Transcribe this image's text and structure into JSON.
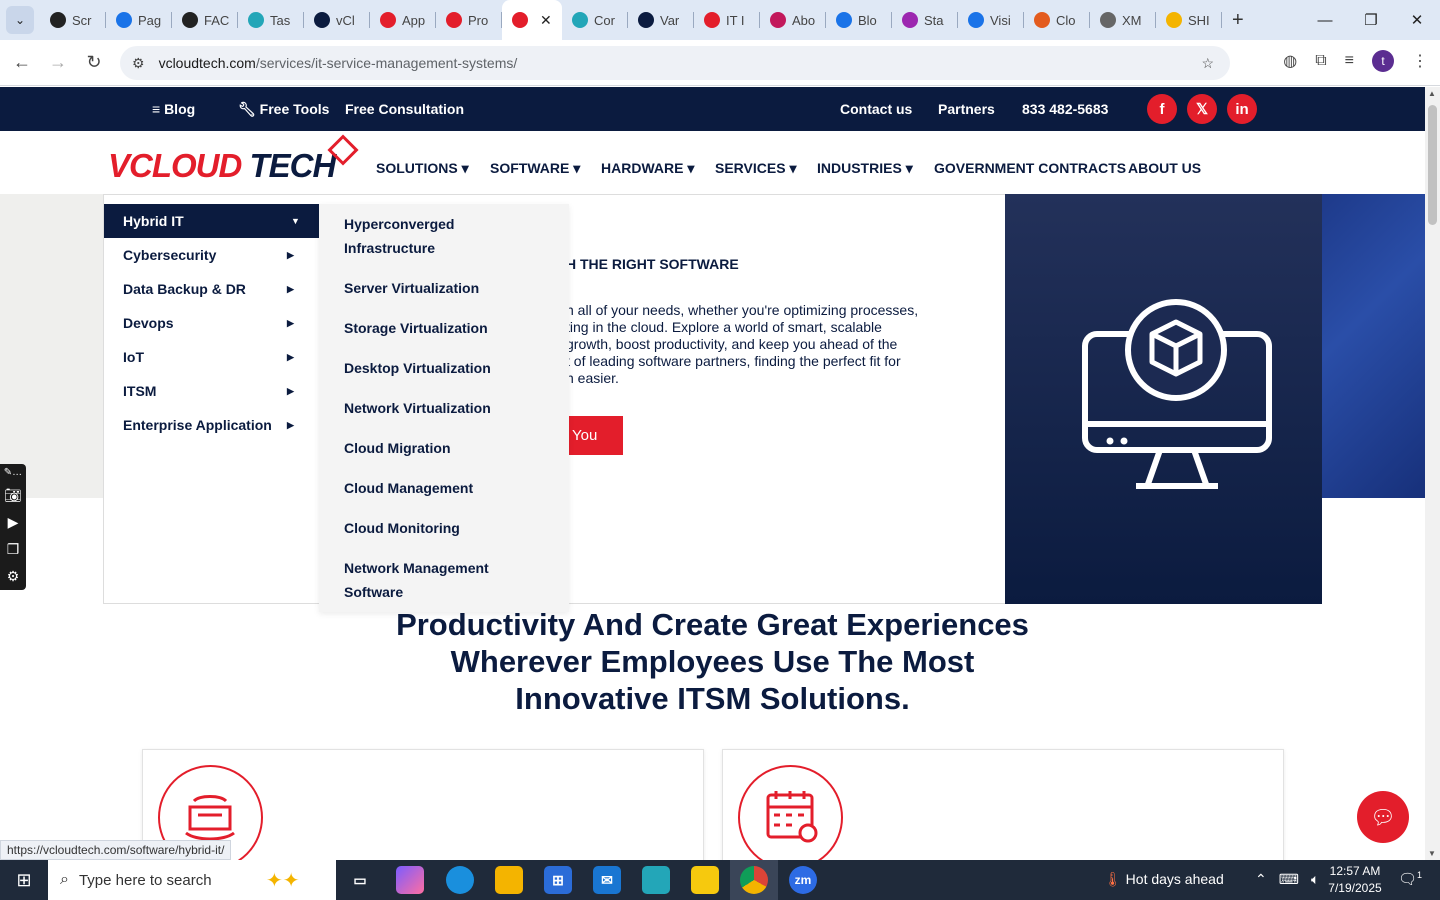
{
  "browser": {
    "tabs": [
      {
        "label": "Scr",
        "color": "#222222"
      },
      {
        "label": "Pag",
        "color": "#1a73e8"
      },
      {
        "label": "FAC",
        "color": "#222222"
      },
      {
        "label": "Tas",
        "color": "#23a6b8"
      },
      {
        "label": "vCl",
        "color": "#0b1b3f"
      },
      {
        "label": "App",
        "color": "#e31e2b"
      },
      {
        "label": "Pro",
        "color": "#e31e2b"
      },
      {
        "label": "",
        "color": "#e31e2b",
        "active": true
      },
      {
        "label": "Cor",
        "color": "#23a6b8"
      },
      {
        "label": "Var",
        "color": "#0b1b3f"
      },
      {
        "label": "IT I",
        "color": "#e31e2b"
      },
      {
        "label": "Abo",
        "color": "#c2185b"
      },
      {
        "label": "Blo",
        "color": "#1a73e8"
      },
      {
        "label": "Sta",
        "color": "#9c27b0"
      },
      {
        "label": "Visi",
        "color": "#1a73e8"
      },
      {
        "label": "Clo",
        "color": "#e35b1e"
      },
      {
        "label": "XM",
        "color": "#666666"
      },
      {
        "label": "SHI",
        "color": "#f4b400"
      }
    ],
    "close_tab": "✕",
    "new_tab": "+",
    "url_host": "vcloudtech.com",
    "url_path": "/services/it-service-management-systems/",
    "profile_initial": "t",
    "status_url": "https://vcloudtech.com/software/hybrid-it/"
  },
  "topbar": {
    "blog": "Blog",
    "free_tools": "Free Tools",
    "free_consultation": "Free Consultation",
    "contact": "Contact us",
    "partners": "Partners",
    "phone": "833 482-5683",
    "social": [
      "f",
      "𝕏",
      "in"
    ]
  },
  "logo": {
    "v": "V",
    "cloud": "CLOUD",
    "tech": " TECH"
  },
  "nav": {
    "items": [
      "SOLUTIONS",
      "SOFTWARE",
      "HARDWARE",
      "SERVICES",
      "INDUSTRIES",
      "GOVERNMENT CONTRACTS",
      "ABOUT US"
    ],
    "caret": "▾"
  },
  "hero": {
    "heading": "H THE RIGHT SOFTWARE",
    "lines": [
      "n all of your needs, whether you're optimizing processes,",
      "ting in the cloud. Explore a world of smart, scalable",
      "growth, boost productivity, and keep you ahead of the",
      "t of leading software partners, finding the perfect fit for",
      "n easier."
    ],
    "button": "You"
  },
  "mega_menu": {
    "categories": [
      "Hybrid IT",
      "Cybersecurity",
      "Data Backup & DR",
      "Devops",
      "IoT",
      "ITSM",
      "Enterprise Application"
    ],
    "selected_index": 0,
    "subitems": [
      [
        "Hyperconverged",
        "Infrastructure"
      ],
      [
        "Server Virtualization"
      ],
      [
        "Storage Virtualization"
      ],
      [
        "Desktop Virtualization"
      ],
      [
        "Network Virtualization"
      ],
      [
        "Cloud Migration"
      ],
      [
        "Cloud Management"
      ],
      [
        "Cloud Monitoring"
      ],
      [
        "Network Management",
        "Software"
      ]
    ]
  },
  "section": {
    "heading_lines": [
      "Productivity And Create Great Experiences",
      "Wherever Employees Use The Most",
      "Innovative ITSM Solutions."
    ]
  },
  "taskbar": {
    "search_placeholder": "Type here to search",
    "weather": "Hot days ahead",
    "time": "12:57 AM",
    "date": "7/19/2025",
    "notifications": "1"
  },
  "colors": {
    "brand_red": "#e31e2b",
    "navy": "#0b1b3f"
  }
}
